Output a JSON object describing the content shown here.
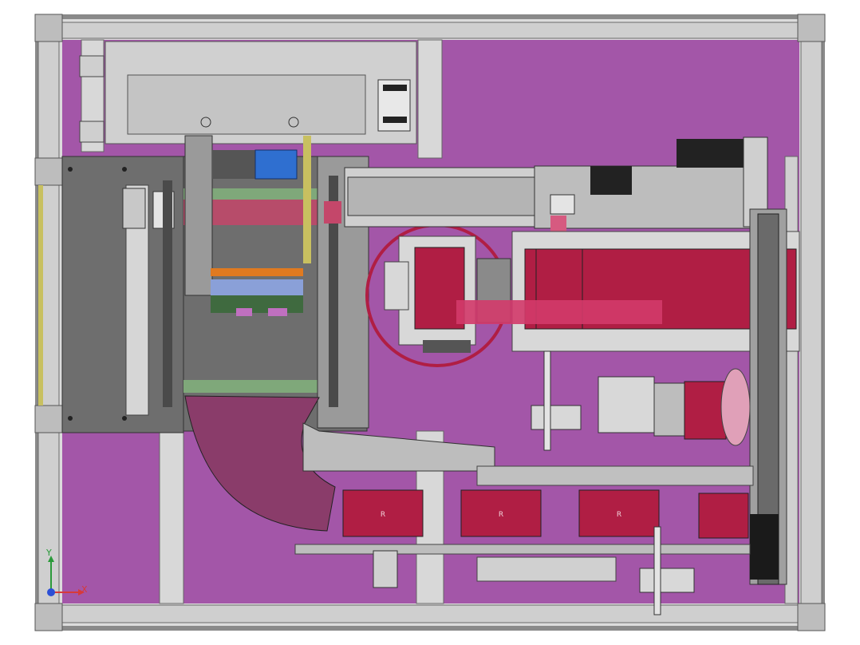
{
  "colors": {
    "background": "#ffffff",
    "frame": "#c9c9c9",
    "frame_dark": "#8a8a8a",
    "magenta": "#a356a8",
    "magenta_dark": "#8a3c8f",
    "plate_gray": "#6e6e6e",
    "crimson": "#b01e44",
    "pink": "#d33a6a",
    "teal": "#6fb8b4",
    "blue_motor": "#2f6fd0",
    "green_strip": "#7fa87a",
    "yellow": "#c8c060",
    "black": "#1a1a1a",
    "axis_x": "#d63a3a",
    "axis_y": "#2a9a3a",
    "axis_z": "#2b4fd6"
  },
  "axis_triad": {
    "x_label": "X",
    "y_label": "Y"
  },
  "pad_markings": {
    "bottom_pads": [
      "R",
      "R",
      "R"
    ]
  }
}
